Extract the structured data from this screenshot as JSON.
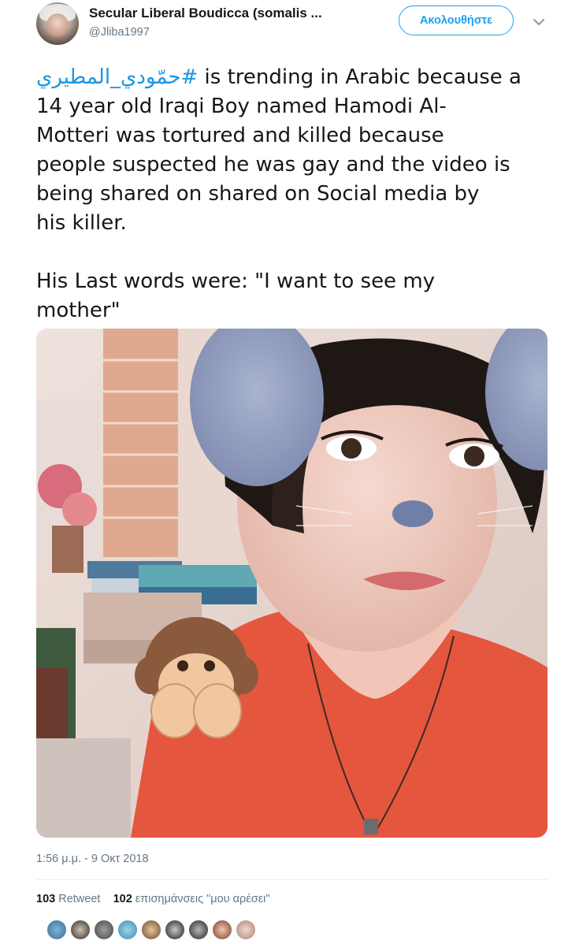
{
  "user": {
    "display_name": "Secular Liberal Boudicca (somalis ...",
    "handle": "@Jliba1997"
  },
  "follow_label": "Ακολουθήστε",
  "tweet": {
    "hashtag": "#حمّودي_المطيري",
    "line1": " is trending in Arabic because a",
    "line2": "14 year old Iraqi Boy named Hamodi Al-",
    "line3": "Motteri was tortured and killed because",
    "line4": "people suspected he was gay and the video is",
    "line5": "being shared on shared on Social media by",
    "line6": "his killer.",
    "line7": "His Last words were: \"I want to see my",
    "line8": "mother\""
  },
  "timestamp": "1:56 μ.μ. - 9 Οκτ 2018",
  "stats": {
    "retweets_count": "103",
    "retweets_label": "Retweet",
    "likes_count": "102",
    "likes_label": "επισημάνσεις \"μου αρέσει\""
  },
  "colors": {
    "accent": "#1da1f2",
    "link": "#1b95e0",
    "secondary_text": "#657786"
  },
  "icons": {
    "more": "chevron-down-icon",
    "photo_emoji": "see-no-evil-monkey"
  }
}
